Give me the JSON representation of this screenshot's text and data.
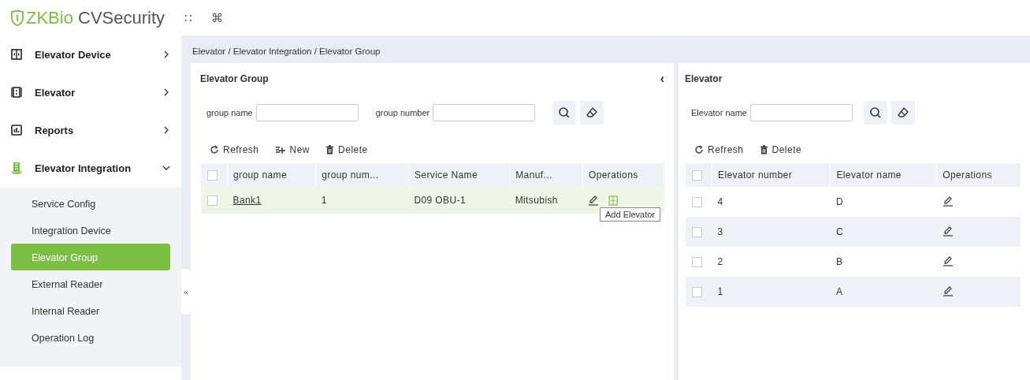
{
  "header": {
    "logo_brand": "ZKBio",
    "logo_product": "CVSecurity",
    "apps_glyph": "∷",
    "cmd_glyph": "⌘"
  },
  "sidebar": {
    "items": [
      {
        "label": "Elevator Device",
        "kind": "device",
        "expanded": false
      },
      {
        "label": "Elevator",
        "kind": "elevator",
        "expanded": false
      },
      {
        "label": "Reports",
        "kind": "reports",
        "expanded": false
      },
      {
        "label": "Elevator Integration",
        "kind": "integration",
        "expanded": true,
        "children": [
          {
            "label": "Service Config",
            "selected": false
          },
          {
            "label": "Integration Device",
            "selected": false
          },
          {
            "label": "Elevator Group",
            "selected": true
          },
          {
            "label": "External Reader",
            "selected": false
          },
          {
            "label": "Internal Reader",
            "selected": false
          },
          {
            "label": "Operation Log",
            "selected": false
          }
        ]
      }
    ],
    "collapse_glyph": "«"
  },
  "breadcrumb": "Elevator / Elevator Integration / Elevator Group",
  "group_panel": {
    "title": "Elevator Group",
    "collapse_glyph": "‹",
    "filters": [
      {
        "label": "group name"
      },
      {
        "label": "group number"
      }
    ],
    "actions": [
      {
        "kind": "refresh",
        "label": "Refresh"
      },
      {
        "kind": "new",
        "label": "New"
      },
      {
        "kind": "delete",
        "label": "Delete"
      }
    ],
    "select_all_checked": false,
    "columns": [
      "group name",
      "group num...",
      "Service Name",
      "Manuf...",
      "Operations"
    ],
    "rows": [
      {
        "checked": false,
        "selected": true,
        "cells": [
          "Bank1",
          "1",
          "D09 OBU-1",
          "Mitsubish"
        ]
      }
    ],
    "tooltip": "Add Elevator"
  },
  "elevator_panel": {
    "title": "Elevator",
    "filters": [
      {
        "label": "Elevator name"
      }
    ],
    "actions": [
      {
        "kind": "refresh",
        "label": "Refresh"
      },
      {
        "kind": "delete",
        "label": "Delete"
      }
    ],
    "select_all_checked": false,
    "columns": [
      "Elevator number",
      "Elevator name",
      "Operations"
    ],
    "rows": [
      {
        "checked": false,
        "cells": [
          "4",
          "D"
        ]
      },
      {
        "checked": false,
        "cells": [
          "3",
          "C"
        ]
      },
      {
        "checked": false,
        "cells": [
          "2",
          "B"
        ]
      },
      {
        "checked": false,
        "cells": [
          "1",
          "A"
        ]
      }
    ]
  }
}
